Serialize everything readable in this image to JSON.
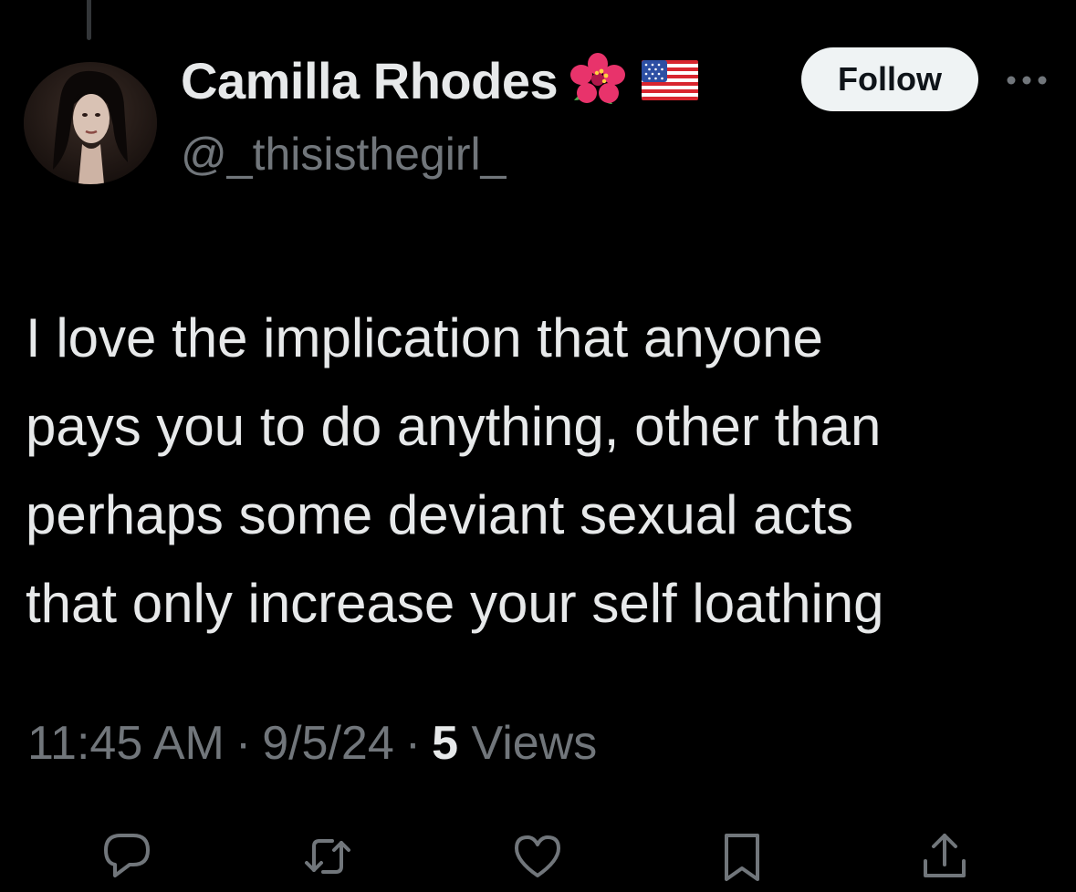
{
  "tweet": {
    "author": {
      "display_name": "Camilla Rhodes",
      "handle": "@_thisisthegirl_",
      "badges": [
        "hibiscus-emoji",
        "us-flag-emoji"
      ]
    },
    "follow_label": "Follow",
    "text_lines": [
      "I love the implication that anyone",
      "pays you to do anything, other than",
      "perhaps some deviant sexual acts",
      "that only increase your self loathing"
    ],
    "time": "11:45 AM",
    "date": "9/5/24",
    "separator": "·",
    "views_count": "5",
    "views_label": "Views"
  },
  "actions": [
    "reply-icon",
    "retweet-icon",
    "like-icon",
    "bookmark-icon",
    "share-icon"
  ],
  "colors": {
    "background": "#000000",
    "primary_text": "#e7e9ea",
    "secondary_text": "#71767b",
    "follow_bg": "#eff3f4",
    "follow_text": "#0f1419"
  }
}
